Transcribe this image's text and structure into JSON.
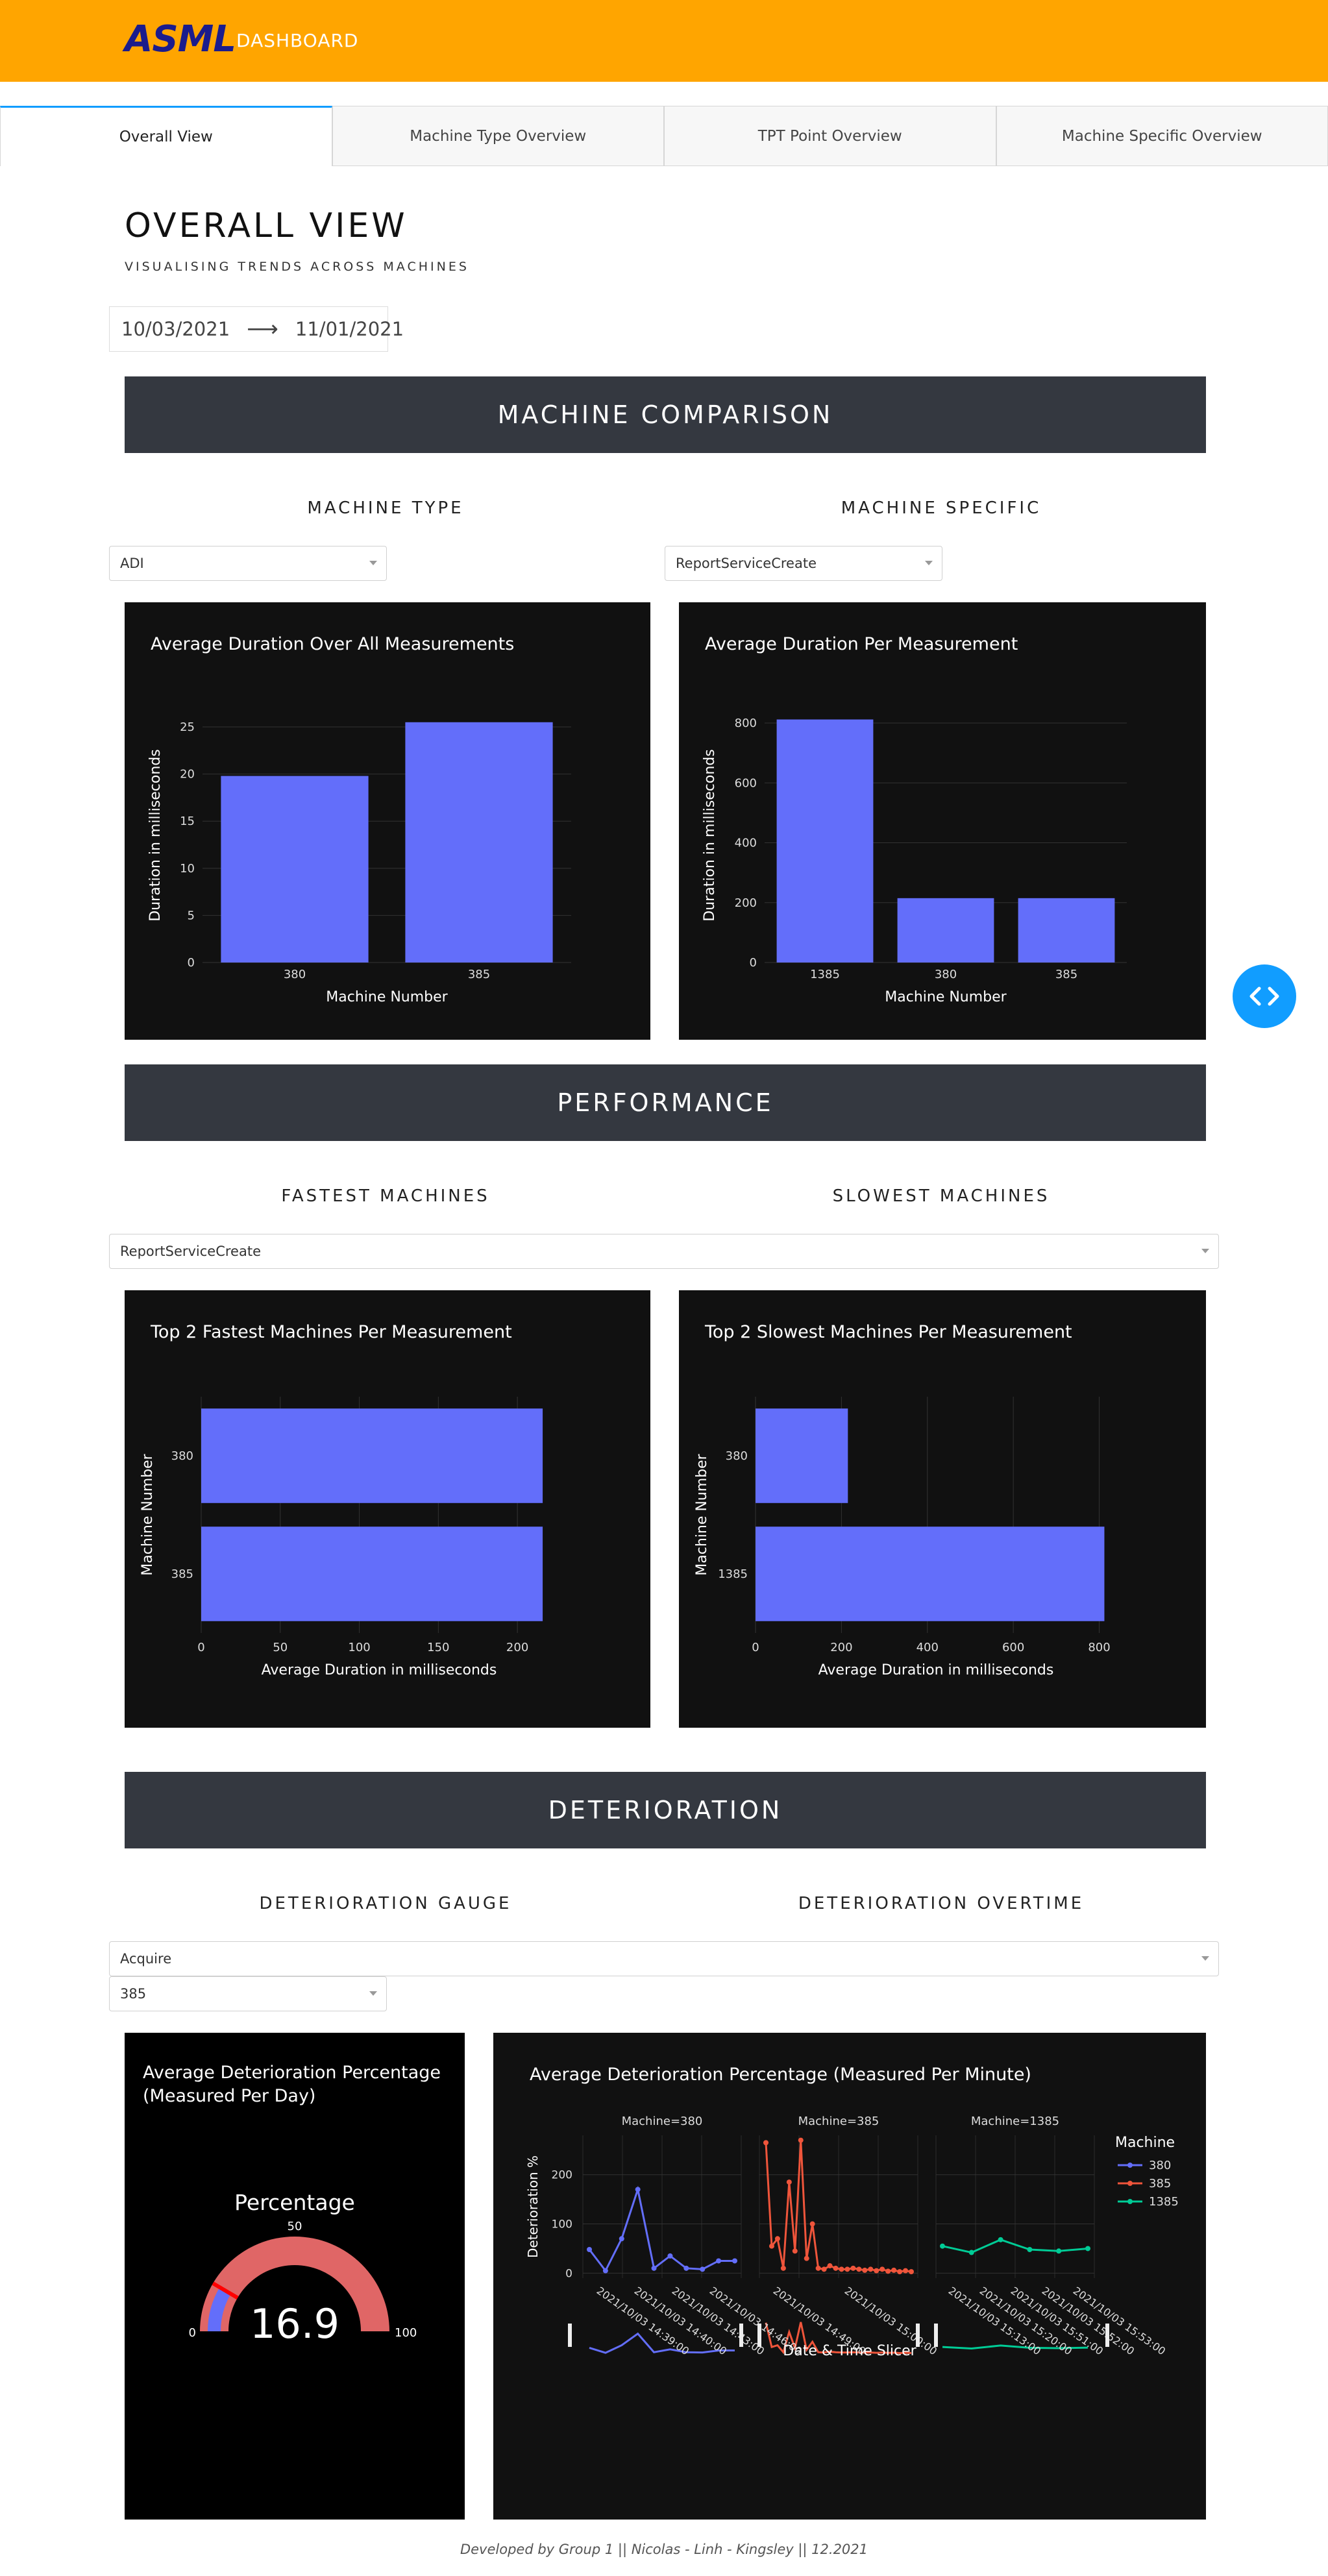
{
  "header": {
    "logo": "ASML",
    "subtitle": "DASHBOARD"
  },
  "tabs": [
    "Overall View",
    "Machine Type Overview",
    "TPT Point Overview",
    "Machine Specific Overview"
  ],
  "page": {
    "title": "OVERALL VIEW",
    "subtitle": "VISUALISING TRENDS ACROSS MACHINES"
  },
  "daterange": {
    "start": "10/03/2021",
    "arrow": "⟶",
    "end": "11/01/2021"
  },
  "sections": {
    "comparison": {
      "title": "MACHINE COMPARISON",
      "left_label": "MACHINE TYPE",
      "right_label": "MACHINE SPECIFIC",
      "left_dropdown": "ADI",
      "right_dropdown": "ReportServiceCreate"
    },
    "performance": {
      "title": "PERFORMANCE",
      "left_label": "FASTEST MACHINES",
      "right_label": "SLOWEST MACHINES",
      "dropdown": "ReportServiceCreate"
    },
    "deterioration": {
      "title": "DETERIORATION",
      "left_label": "DETERIORATION GAUGE",
      "right_label": "DETERIORATION OVERTIME",
      "dropdown": "Acquire",
      "dropdown2": "385"
    }
  },
  "colors": {
    "header": "#ffa500",
    "logo": "#1b1c8c",
    "bar": "#636efa",
    "banner": "#343840",
    "panel": "#111111",
    "series_380": "#636efa",
    "series_385": "#ef553b",
    "series_1385": "#00cc96",
    "nav": "#119dff"
  },
  "chart_data": [
    {
      "type": "bar",
      "title": "Average Duration Over All Measurements",
      "xlabel": "Machine Number",
      "ylabel": "Duration in milliseconds",
      "categories": [
        "380",
        "385"
      ],
      "values": [
        19.8,
        25.5
      ],
      "ylim": [
        0,
        27
      ],
      "yticks": [
        0,
        5,
        10,
        15,
        20,
        25
      ]
    },
    {
      "type": "bar",
      "title": "Average Duration Per Measurement",
      "xlabel": "Machine Number",
      "ylabel": "Duration in milliseconds",
      "categories": [
        "1385",
        "380",
        "385"
      ],
      "values": [
        812,
        215,
        215
      ],
      "ylim": [
        0,
        850
      ],
      "yticks": [
        0,
        200,
        400,
        600,
        800
      ]
    },
    {
      "type": "bar",
      "orientation": "horizontal",
      "title": "Top 2 Fastest Machines Per Measurement",
      "xlabel": "Average Duration in milliseconds",
      "ylabel": "Machine Number",
      "categories": [
        "380",
        "385"
      ],
      "values": [
        216,
        216
      ],
      "xlim": [
        0,
        225
      ],
      "xticks": [
        0,
        50,
        100,
        150,
        200
      ]
    },
    {
      "type": "bar",
      "orientation": "horizontal",
      "title": "Top 2 Slowest Machines Per Measurement",
      "xlabel": "Average Duration in milliseconds",
      "ylabel": "Machine Number",
      "categories": [
        "380",
        "1385"
      ],
      "values": [
        215,
        812
      ],
      "xlim": [
        0,
        840
      ],
      "xticks": [
        0,
        200,
        400,
        600,
        800
      ]
    },
    {
      "type": "gauge",
      "title": "Average Deterioration Percentage (Measured Per Day)",
      "label": "Percentage",
      "value": 16.9,
      "range": [
        0,
        100
      ],
      "tick_labels": [
        "0",
        "50",
        "100"
      ]
    },
    {
      "type": "line",
      "title": "Average Deterioration Percentage (Measured Per Minute)",
      "ylabel": "Deterioration %",
      "legend_title": "Machine",
      "legend_position": "right",
      "slider_label": "Date & Time Slicer",
      "yticks": [
        0,
        100,
        200
      ],
      "ylim": [
        -10,
        280
      ],
      "series": [
        {
          "name": "380",
          "facet": "Machine=380",
          "values": [
            48,
            5,
            70,
            170,
            10,
            35,
            10,
            8,
            25,
            25
          ]
        },
        {
          "name": "385",
          "facet": "Machine=385",
          "values": [
            265,
            55,
            70,
            10,
            185,
            45,
            270,
            30,
            100,
            10,
            8,
            15,
            10,
            8,
            8,
            10,
            8,
            6,
            8,
            5,
            8,
            4,
            6,
            3,
            5,
            3
          ]
        },
        {
          "name": "1385",
          "facet": "Machine=1385",
          "values": [
            55,
            42,
            68,
            48,
            45,
            50
          ]
        }
      ],
      "x_tick_labels": [
        "2021/10/03 14:39:00",
        "2021/10/03 14:40:00",
        "2021/10/03 14:43:00",
        "2021/10/03 14:46:00",
        "2021/10/03 14:49:00",
        "2021/10/03 15:00:00",
        "2021/10/03 15:13:00",
        "2021/10/03 15:20:00",
        "2021/10/03 15:51:00",
        "2021/10/03 15:52:00",
        "2021/10/03 15:53:00"
      ]
    }
  ],
  "footer": "Developed by Group 1 || Nicolas - Linh - Kingsley || 12.2021"
}
